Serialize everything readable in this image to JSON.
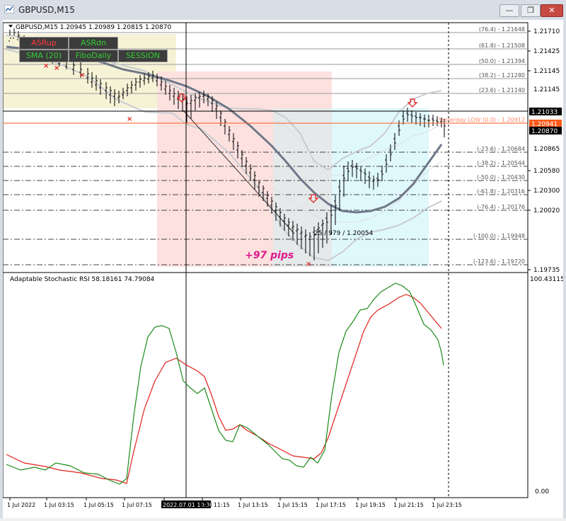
{
  "window": {
    "title": "GBPUSD,M15",
    "minimize_label": "—",
    "restore_label": "❐",
    "close_label": "✕"
  },
  "price_chart": {
    "header": "GBPUSD,M15  1.20945 1.20989 1.20815 1.20870",
    "price_axis": [
      "1.21710",
      "1.21425",
      "1.21145",
      "1.20865",
      "1.20580",
      "1.20300",
      "1.20020",
      "1.19735",
      "1.21033",
      "1.20941",
      "1.20870"
    ],
    "tags": {
      "high": "1.21033",
      "current": "1.20941",
      "last": "1.20870"
    },
    "fibo_levels": [
      "(76.4) - 1.21648",
      "(61.8) - 1.21508",
      "(50.0) - 1.21394",
      "(38.2) - 1.21280",
      "(23.6) - 1.21140",
      "Yesterday LOW (0.0) - 1.20912",
      "(-23.6) - 1.20684",
      "(-38.2) - 1.20544",
      "(-50.0) - 1.20430",
      "(-61.8) - 1.20316",
      "(-76.4) - 1.20176",
      "(-100.0) - 1.19948",
      "(-123.6) - 1.19720"
    ],
    "crosshair_label": "25 / 979 / 1.20054",
    "pips_label": "+97  pips",
    "buttons": {
      "asr_up": "ASRup",
      "asr_dn": "ASRdn",
      "sma": "SMA (20)",
      "fibo_daily": "FiboDaily",
      "session": "SESSION"
    },
    "button_colors": {
      "asr_up": "#ff3b3b",
      "asr_dn": "#33cc33",
      "sma": "#33cc33",
      "fibo_daily": "#33cc33",
      "session": "#33cc33"
    }
  },
  "indicator": {
    "label": "Adaptable Stochastic RSI 58.18161 74.79084",
    "axis_top": "100.43115",
    "axis_bottom": "0.00"
  },
  "time_axis": {
    "labels": [
      "1 Jul 2022",
      "1 Jul 03:15",
      "1 Jul 05:15",
      "1 Jul 07:15",
      "2022.07.01 10:30",
      "1 Jul 11:15",
      "1 Jul 13:15",
      "1 Jul 15:15",
      "1 Jul 17:15",
      "1 Jul 19:15",
      "1 Jul 21:15",
      "1 Jul 23:15"
    ]
  },
  "colors": {
    "session_asia": "#f6f2d6",
    "session_london": "#fde1df",
    "session_ny": "#dff8fc",
    "overlap": "#e6e6e6",
    "sma": "#6e7888",
    "stoch_main": "#1a8a1a",
    "stoch_signal": "#e0201a",
    "up_arrow": "#e03030",
    "pips_text": "#e0188a",
    "current_price": "#ff5a1a"
  }
}
